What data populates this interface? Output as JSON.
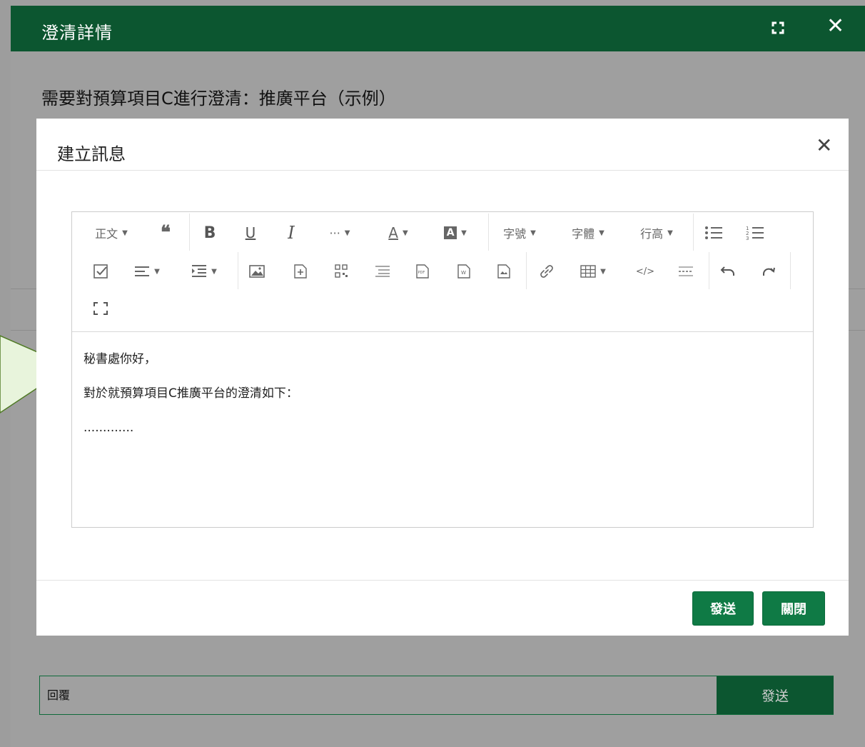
{
  "outer": {
    "title": "澄清詳情",
    "subject": "需要對預算項目C進行澄清：推廣平台（示例）",
    "reply_placeholder": "回覆",
    "reply_send": "發送"
  },
  "dialog": {
    "title": "建立訊息",
    "send_label": "發送",
    "close_label": "關閉"
  },
  "toolbar": {
    "paragraph": "正文",
    "font_size": "字號",
    "font_family": "字體",
    "line_height": "行高"
  },
  "content": {
    "lines": [
      "秘書處你好，",
      "對於就預算項目C推廣平台的澄清如下：",
      "............."
    ]
  },
  "colors": {
    "header_green": "#0c5630",
    "button_green": "#0f7a45",
    "overlay_gray": "#9f9f9f",
    "callout_fill": "#e8f4dc",
    "callout_stroke": "#4f7a24"
  }
}
